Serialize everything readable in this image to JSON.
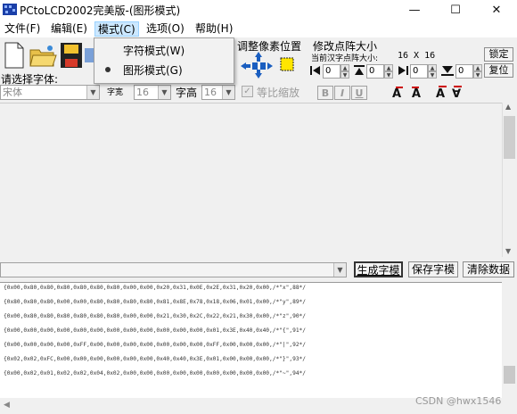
{
  "window": {
    "title": "PCtoLCD2002完美版-(图形模式)",
    "min_glyph": "—",
    "max_glyph": "☐",
    "close_glyph": "✕"
  },
  "menu": {
    "file": "文件(F)",
    "edit": "编辑(E)",
    "mode": "模式(C)",
    "options": "选项(O)",
    "help": "帮助(H)"
  },
  "mode_menu": {
    "items": [
      "字符模式(W)",
      "图形模式(G)"
    ],
    "selected": "图形模式(G)",
    "bullet": "●"
  },
  "toolbar": {
    "adjust_pixel_label": "调整像素位置",
    "resize_label": "修改点阵大小",
    "current_size_label": "当前汉字点阵大小:",
    "size_value": "16 X 16",
    "lock_button": "锁定",
    "restore_button": "复位",
    "spin_values": [
      "0",
      "0",
      "0",
      "0"
    ],
    "choose_font_label": "请选择字体:",
    "font_value": "宋体",
    "char_width_label": "字宽",
    "char_width_value": "16",
    "char_height_label": "字高",
    "char_height_value": "16",
    "proportional_label": "等比缩放",
    "bold_label": "B",
    "italic_label": "I",
    "underline_label": "U"
  },
  "actions": {
    "generate_button": "生成字模",
    "save_button": "保存字模",
    "clear_button": "清除数据"
  },
  "output": {
    "lines": [
      "{0x00,0x80,0x80,0x80,0x80,0x80,0x80,0x00,0x00,0x20,0x31,0x0E,0x2E,0x31,0x20,0x00,/*\"x\",88*/",
      "{0x80,0x80,0x80,0x00,0x00,0x80,0x80,0x80,0x80,0x81,0x8E,0x78,0x18,0x06,0x01,0x00,/*\"y\",89*/",
      "{0x00,0x80,0x80,0x80,0x80,0x80,0x80,0x00,0x00,0x21,0x30,0x2C,0x22,0x21,0x30,0x00,/*\"z\",90*/",
      "{0x00,0x00,0x00,0x00,0x00,0x00,0x00,0x00,0x00,0x00,0x00,0x00,0x01,0x3E,0x40,0x40,/*\"{\",91*/",
      "{0x00,0x00,0x00,0x00,0xFF,0x00,0x00,0x00,0x00,0x00,0x00,0x00,0xFF,0x00,0x00,0x00,/*\"|\",92*/",
      "{0x02,0x02,0xFC,0x00,0x00,0x00,0x00,0x00,0x00,0x40,0x40,0x3E,0x01,0x00,0x00,0x00,/*\"}\",93*/",
      "{0x00,0x02,0x01,0x02,0x02,0x04,0x02,0x00,0x00,0x00,0x00,0x00,0x00,0x00,0x00,0x00,/*\"~\",94*/"
    ]
  },
  "watermark": "CSDN @hwx1546"
}
